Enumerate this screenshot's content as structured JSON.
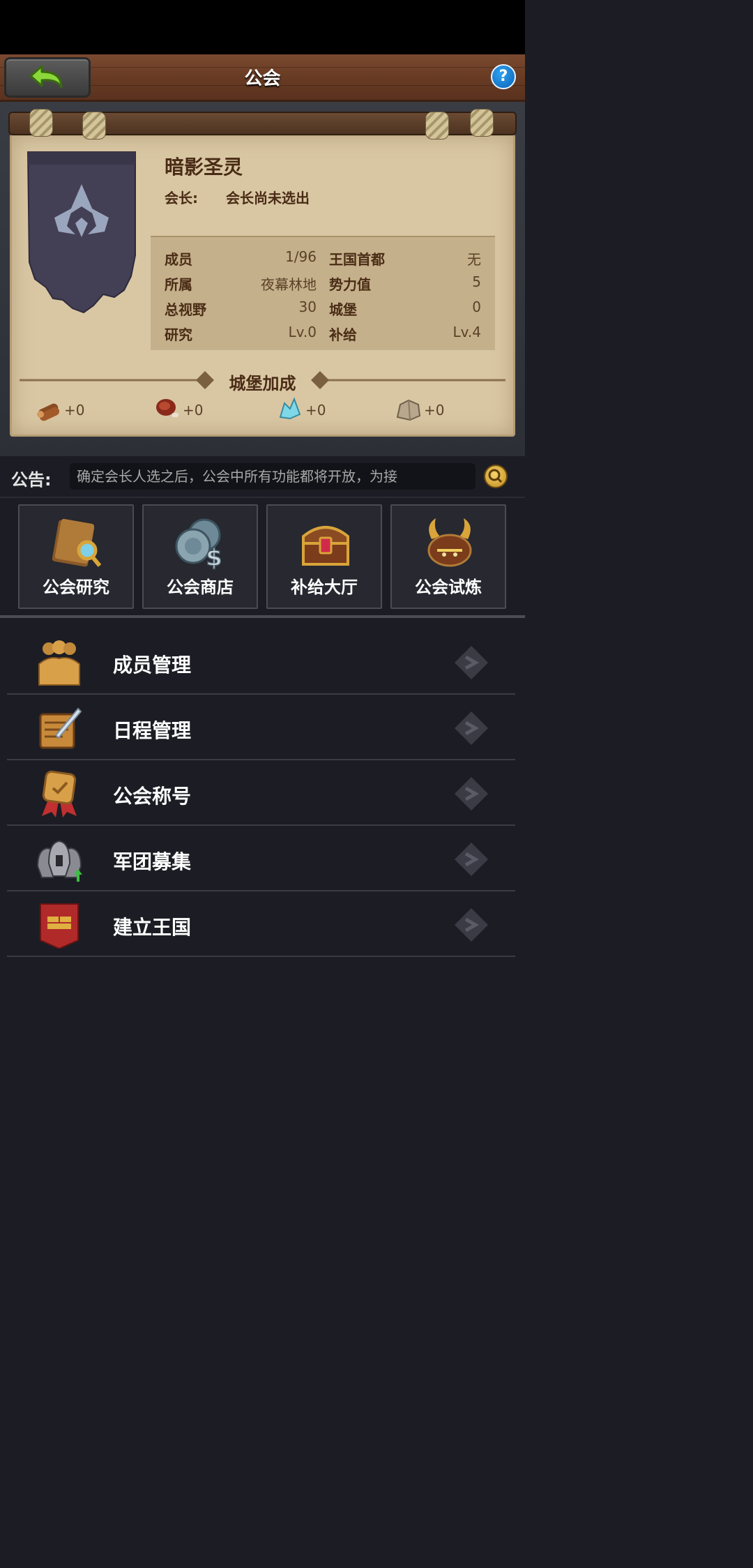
{
  "header": {
    "title": "公会"
  },
  "guild": {
    "name": "暗影圣灵",
    "leader_label": "会长:",
    "leader_value": "会长尚未选出"
  },
  "stats": {
    "members_label": "成员",
    "members_value": "1/96",
    "capital_label": "王国首都",
    "capital_value": "无",
    "region_label": "所属",
    "region_value": "夜幕林地",
    "power_label": "势力值",
    "power_value": "5",
    "vision_label": "总视野",
    "vision_value": "30",
    "castle_label": "城堡",
    "castle_value": "0",
    "research_label": "研究",
    "research_value": "Lv.0",
    "supply_label": "补给",
    "supply_value": "Lv.4"
  },
  "bonus": {
    "title": "城堡加成",
    "wood": "+0",
    "meat": "+0",
    "crystal": "+0",
    "stone": "+0"
  },
  "announcement": {
    "label": "公告:",
    "text": "确定会长人选之后，公会中所有功能都将开放，为接"
  },
  "tiles": [
    {
      "label": "公会研究"
    },
    {
      "label": "公会商店"
    },
    {
      "label": "补给大厅"
    },
    {
      "label": "公会试炼"
    }
  ],
  "menu": [
    {
      "label": "成员管理"
    },
    {
      "label": "日程管理"
    },
    {
      "label": "公会称号"
    },
    {
      "label": "军团募集"
    },
    {
      "label": "建立王国"
    }
  ],
  "colors": {
    "header_wood": "#6a3c24",
    "parchment": "#d9c7a4",
    "text_brown": "#4a2c16",
    "background": "#1c1d24",
    "help_blue": "#0a62b8"
  }
}
